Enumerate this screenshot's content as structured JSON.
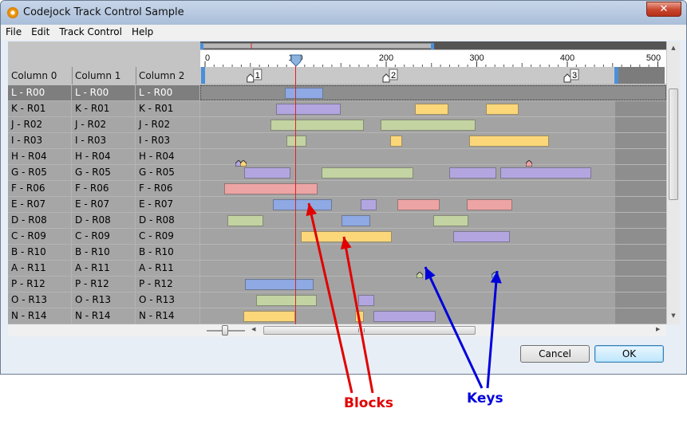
{
  "window": {
    "title": "Codejock Track Control Sample",
    "close_glyph": "✕"
  },
  "menu": [
    "File",
    "Edit",
    "Track Control",
    "Help"
  ],
  "columns": [
    "Column 0",
    "Column 1",
    "Column 2"
  ],
  "ruler": {
    "ticks": [
      "0",
      "100",
      "200",
      "300",
      "400",
      "500"
    ]
  },
  "markers": [
    "1",
    "2",
    "3"
  ],
  "rows": [
    {
      "cells": [
        "L - R00",
        "L - R00",
        "L - R00"
      ],
      "selected": true,
      "blocks": [
        {
          "start": 88,
          "end": 130,
          "color": "blue"
        }
      ]
    },
    {
      "cells": [
        "K - R01",
        "K - R01",
        "K - R01"
      ],
      "blocks": [
        {
          "start": 78,
          "end": 150,
          "color": "purple"
        },
        {
          "start": 232,
          "end": 269,
          "color": "yellow"
        },
        {
          "start": 310,
          "end": 346,
          "color": "yellow"
        }
      ]
    },
    {
      "cells": [
        "J - R02",
        "J - R02",
        "J - R02"
      ],
      "blocks": [
        {
          "start": 72,
          "end": 175,
          "color": "green"
        },
        {
          "start": 194,
          "end": 299,
          "color": "green"
        }
      ]
    },
    {
      "cells": [
        "I - R03",
        "I - R03",
        "I - R03"
      ],
      "blocks": [
        {
          "start": 90,
          "end": 112,
          "color": "green"
        },
        {
          "start": 204,
          "end": 218,
          "color": "yellow"
        },
        {
          "start": 292,
          "end": 380,
          "color": "yellow"
        }
      ]
    },
    {
      "cells": [
        "H - R04",
        "H - R04",
        "H - R04"
      ],
      "blocks": [],
      "keys": [
        {
          "pos": 37,
          "color": "purple"
        },
        {
          "pos": 42,
          "color": "yellow"
        },
        {
          "pos": 358,
          "color": "red"
        }
      ]
    },
    {
      "cells": [
        "G - R05",
        "G - R05",
        "G - R05"
      ],
      "blocks": [
        {
          "start": 43,
          "end": 94,
          "color": "purple"
        },
        {
          "start": 129,
          "end": 230,
          "color": "green"
        },
        {
          "start": 270,
          "end": 322,
          "color": "purple"
        },
        {
          "start": 326,
          "end": 426,
          "color": "purple"
        }
      ]
    },
    {
      "cells": [
        "F - R06",
        "F - R06",
        "F - R06"
      ],
      "blocks": [
        {
          "start": 21,
          "end": 124,
          "color": "red"
        }
      ]
    },
    {
      "cells": [
        "E - R07",
        "E - R07",
        "E - R07"
      ],
      "blocks": [
        {
          "start": 75,
          "end": 140,
          "color": "blue"
        },
        {
          "start": 172,
          "end": 189,
          "color": "purple"
        },
        {
          "start": 212,
          "end": 259,
          "color": "red"
        },
        {
          "start": 289,
          "end": 339,
          "color": "red"
        }
      ]
    },
    {
      "cells": [
        "D - R08",
        "D - R08",
        "D - R08"
      ],
      "blocks": [
        {
          "start": 25,
          "end": 64,
          "color": "green"
        },
        {
          "start": 151,
          "end": 182,
          "color": "blue"
        },
        {
          "start": 252,
          "end": 291,
          "color": "green"
        }
      ]
    },
    {
      "cells": [
        "C - R09",
        "C - R09",
        "C - R09"
      ],
      "blocks": [
        {
          "start": 106,
          "end": 206,
          "color": "yellow"
        },
        {
          "start": 274,
          "end": 337,
          "color": "purple"
        }
      ]
    },
    {
      "cells": [
        "B - R10",
        "B - R10",
        "B - R10"
      ],
      "blocks": []
    },
    {
      "cells": [
        "A - R11",
        "A - R11",
        "A - R11"
      ],
      "blocks": [],
      "keys": [
        {
          "pos": 237,
          "color": "green"
        },
        {
          "pos": 320,
          "color": "blue"
        }
      ]
    },
    {
      "cells": [
        "P - R12",
        "P - R12",
        "P - R12"
      ],
      "blocks": [
        {
          "start": 44,
          "end": 120,
          "color": "blue"
        }
      ]
    },
    {
      "cells": [
        "O - R13",
        "O - R13",
        "O - R13"
      ],
      "blocks": [
        {
          "start": 56,
          "end": 123,
          "color": "green"
        },
        {
          "start": 169,
          "end": 187,
          "color": "purple"
        }
      ]
    },
    {
      "cells": [
        "N - R14",
        "N - R14",
        "N - R14"
      ],
      "blocks": [
        {
          "start": 42,
          "end": 100,
          "color": "yellow"
        },
        {
          "start": 166,
          "end": 175,
          "color": "yellow"
        },
        {
          "start": 186,
          "end": 255,
          "color": "purple"
        }
      ]
    }
  ],
  "colors": {
    "blue": "#8ea9e3",
    "purple": "#b3a6e0",
    "green": "#c3d3a2",
    "yellow": "#fbd77a",
    "red": "#eda4a4",
    "time_cursor": "#dd2222",
    "annotation_red": "#e10000",
    "annotation_blue": "#0000dc"
  },
  "time_cursor": 100,
  "buttons": {
    "cancel": "Cancel",
    "ok": "OK"
  },
  "scroll_arrows": {
    "up": "▲",
    "down": "▼",
    "left": "◀",
    "right": "▶"
  },
  "annotations": {
    "blocks": "Blocks",
    "keys": "Keys"
  }
}
